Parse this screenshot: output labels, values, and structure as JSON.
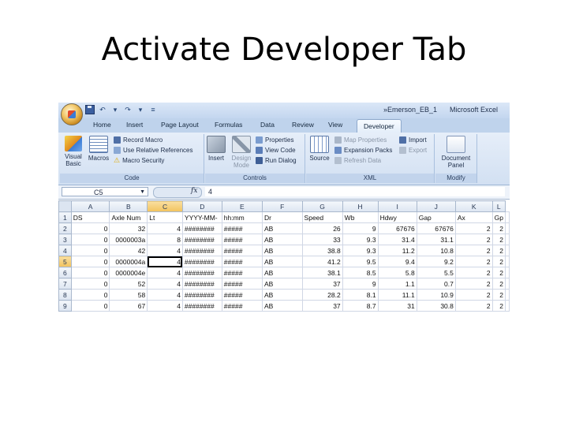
{
  "slide": {
    "title": "Activate Developer Tab"
  },
  "window": {
    "filename": "»Emerson_EB_1",
    "app": "Microsoft Excel"
  },
  "ribbon_tabs": [
    "Home",
    "Insert",
    "Page Layout",
    "Formulas",
    "Data",
    "Review",
    "View",
    "Developer"
  ],
  "active_tab": "Developer",
  "groups": {
    "code": {
      "label": "Code",
      "visual_basic": "Visual Basic",
      "macros": "Macros",
      "record_macro": "Record Macro",
      "relative_refs": "Use Relative References",
      "macro_security": "Macro Security"
    },
    "controls": {
      "label": "Controls",
      "insert": "Insert",
      "design_mode": "Design Mode",
      "properties": "Properties",
      "view_code": "View Code",
      "run_dialog": "Run Dialog"
    },
    "xml": {
      "label": "XML",
      "source": "Source",
      "map_properties": "Map Properties",
      "expansion_packs": "Expansion Packs",
      "refresh_data": "Refresh Data",
      "import": "Import",
      "export": "Export"
    },
    "modify": {
      "label": "Modify",
      "document_panel": "Document Panel"
    }
  },
  "formula_bar": {
    "cell_ref": "C5",
    "fx": "fx",
    "value": "4"
  },
  "sheet": {
    "columns": [
      "A",
      "B",
      "C",
      "D",
      "E",
      "F",
      "G",
      "H",
      "I",
      "J",
      "K",
      "L"
    ],
    "selected_column": "C",
    "selected_row": "5",
    "rows": [
      {
        "n": "1",
        "cells": [
          "DS",
          "Axle Num",
          "Lt",
          "YYYY-MM-",
          "hh:mm",
          "Dr",
          "Speed",
          "Wb",
          "Hdwy",
          "Gap",
          "Ax",
          "Gp"
        ]
      },
      {
        "n": "2",
        "cells": [
          "0",
          "32",
          "4",
          "########",
          "#####",
          "AB",
          "26",
          "9",
          "67676",
          "67676",
          "2",
          "2"
        ]
      },
      {
        "n": "3",
        "cells": [
          "0",
          "0000003a",
          "8",
          "########",
          "#####",
          "AB",
          "33",
          "9.3",
          "31.4",
          "31.1",
          "2",
          "2"
        ]
      },
      {
        "n": "4",
        "cells": [
          "0",
          "42",
          "4",
          "########",
          "#####",
          "AB",
          "38.8",
          "9.3",
          "11.2",
          "10.8",
          "2",
          "2"
        ]
      },
      {
        "n": "5",
        "cells": [
          "0",
          "0000004a",
          "4",
          "########",
          "#####",
          "AB",
          "41.2",
          "9.5",
          "9.4",
          "9.2",
          "2",
          "2"
        ]
      },
      {
        "n": "6",
        "cells": [
          "0",
          "0000004e",
          "4",
          "########",
          "#####",
          "AB",
          "38.1",
          "8.5",
          "5.8",
          "5.5",
          "2",
          "2"
        ]
      },
      {
        "n": "7",
        "cells": [
          "0",
          "52",
          "4",
          "########",
          "#####",
          "AB",
          "37",
          "9",
          "1.1",
          "0.7",
          "2",
          "2"
        ]
      },
      {
        "n": "8",
        "cells": [
          "0",
          "58",
          "4",
          "########",
          "#####",
          "AB",
          "28.2",
          "8.1",
          "11.1",
          "10.9",
          "2",
          "2"
        ]
      },
      {
        "n": "9",
        "cells": [
          "0",
          "67",
          "4",
          "########",
          "#####",
          "AB",
          "37",
          "8.7",
          "31",
          "30.8",
          "2",
          "2"
        ]
      }
    ]
  },
  "colors": {
    "ribbon": "#dbe6f5",
    "selected_header": "#f2c35d",
    "tab_bar": "#bfd3ec"
  }
}
